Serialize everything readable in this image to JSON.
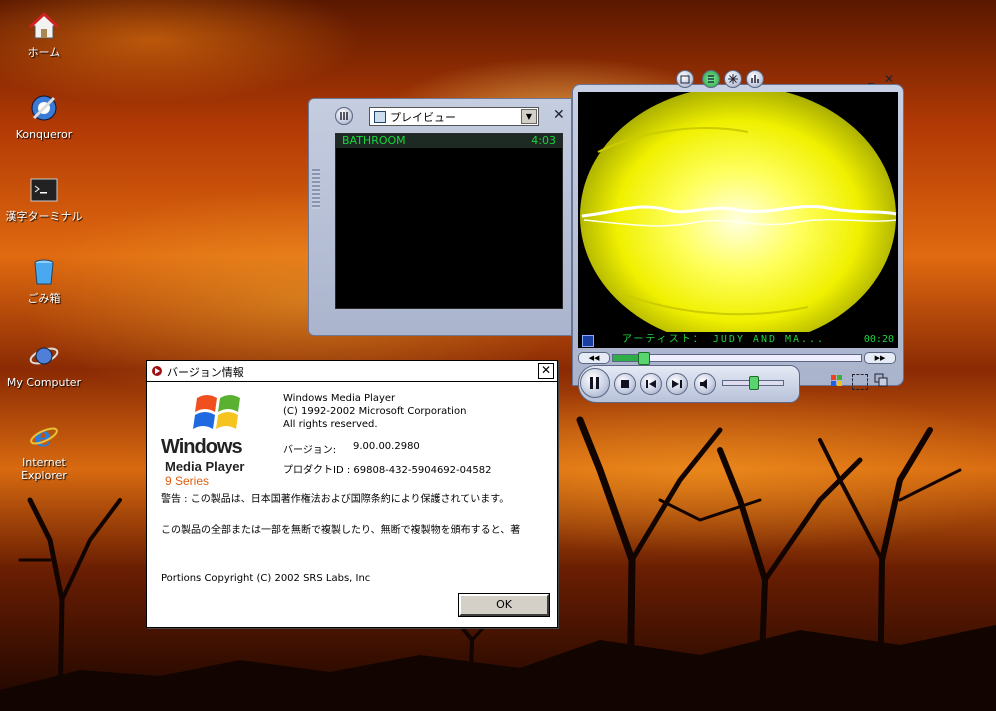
{
  "desktop": {
    "icons": [
      {
        "label": "ホーム",
        "icon": "home-icon"
      },
      {
        "label": "Konqueror",
        "icon": "konqueror-icon"
      },
      {
        "label": "漢字ターミナル",
        "icon": "terminal-icon"
      },
      {
        "label": "ごみ箱",
        "icon": "trash-icon"
      },
      {
        "label": "My Computer",
        "icon": "computer-icon"
      },
      {
        "label": "Internet Explorer",
        "icon": "ie-icon"
      }
    ]
  },
  "playlist": {
    "dropdown_value": "プレイビュー",
    "items": [
      {
        "title": "BATHROOM",
        "duration": "4:03"
      }
    ]
  },
  "player": {
    "status_text": "アーティスト： JUDY AND MA...",
    "time": "00:20",
    "seek_fraction": 0.12,
    "volume_fraction": 0.5,
    "accent": "#1bd43b",
    "vis_color": "#ffff00"
  },
  "about": {
    "title": "バージョン情報",
    "logo_lines": [
      "Windows",
      "Media Player",
      "9 Series"
    ],
    "product": "Windows Media Player",
    "copyright": "(C) 1992-2002 Microsoft Corporation",
    "rights": "All rights reserved.",
    "version_label": "バージョン:",
    "version_value": "9.00.00.2980",
    "product_id": "プロダクトID : 69808-432-5904692-04582",
    "warning1": "警告 : この製品は、日本国著作権法および国際条約により保護されています。",
    "warning2": "この製品の全部または一部を無断で複製したり、無断で複製物を頒布すると、著",
    "portions": "Portions Copyright (C) 2002 SRS Labs, Inc",
    "ok_label": "OK"
  }
}
